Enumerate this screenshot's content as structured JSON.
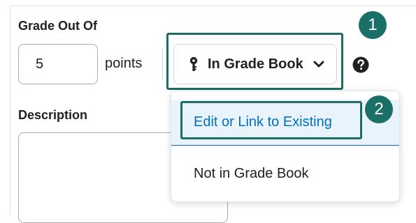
{
  "grade": {
    "heading": "Grade Out Of",
    "value": "5",
    "unit_label": "points"
  },
  "gradebook": {
    "button_label": "In Grade Book",
    "menu_items": [
      "Edit or Link to Existing",
      "Not in Grade Book"
    ],
    "selected_index": 0
  },
  "description": {
    "heading": "Description"
  },
  "callouts": {
    "step1": "1",
    "step2": "2"
  },
  "icons": {
    "pin": "key-pin-icon",
    "dropdown": "chevron-down-icon",
    "help": "help-circle-icon"
  },
  "colors": {
    "highlight_border": "#1d6b65",
    "badge": "#1a6f67",
    "selected_bg": "#e8f3fb",
    "selected_text": "#006fbf"
  }
}
